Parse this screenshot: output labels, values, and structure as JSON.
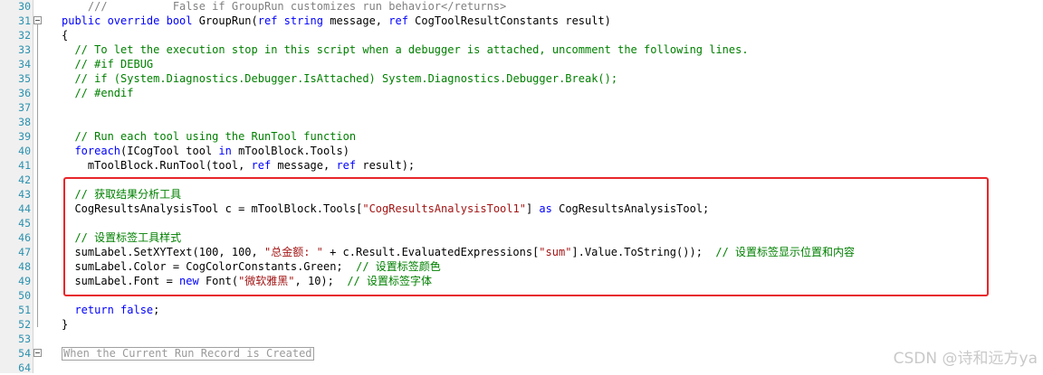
{
  "editor": {
    "lines": [
      {
        "num": "30",
        "parts": [
          {
            "t": "    ///          False if GroupRun customizes run behavior</returns>",
            "c": "doc"
          }
        ]
      },
      {
        "num": "31",
        "parts": [
          {
            "t": "public override bool ",
            "c": "kw"
          },
          {
            "t": "GroupRun(",
            "c": ""
          },
          {
            "t": "ref string ",
            "c": "kw"
          },
          {
            "t": "message, ",
            "c": ""
          },
          {
            "t": "ref ",
            "c": "kw"
          },
          {
            "t": "CogToolResultConstants result)",
            "c": ""
          }
        ]
      },
      {
        "num": "32",
        "parts": [
          {
            "t": "{",
            "c": ""
          }
        ]
      },
      {
        "num": "33",
        "parts": [
          {
            "t": "  // To let the execution stop in this script when a debugger is attached, uncomment the following lines.",
            "c": "cm"
          }
        ]
      },
      {
        "num": "34",
        "parts": [
          {
            "t": "  // #if DEBUG",
            "c": "cm"
          }
        ]
      },
      {
        "num": "35",
        "parts": [
          {
            "t": "  // if (System.Diagnostics.Debugger.IsAttached) System.Diagnostics.Debugger.Break();",
            "c": "cm"
          }
        ]
      },
      {
        "num": "36",
        "parts": [
          {
            "t": "  // #endif",
            "c": "cm"
          }
        ]
      },
      {
        "num": "37",
        "parts": []
      },
      {
        "num": "38",
        "parts": []
      },
      {
        "num": "39",
        "parts": [
          {
            "t": "  // Run each tool using the RunTool function",
            "c": "cm"
          }
        ]
      },
      {
        "num": "40",
        "parts": [
          {
            "t": "  ",
            "c": ""
          },
          {
            "t": "foreach",
            "c": "kw"
          },
          {
            "t": "(ICogTool tool ",
            "c": ""
          },
          {
            "t": "in ",
            "c": "kw"
          },
          {
            "t": "mToolBlock.Tools)",
            "c": ""
          }
        ]
      },
      {
        "num": "41",
        "parts": [
          {
            "t": "    mToolBlock.RunTool(tool, ",
            "c": ""
          },
          {
            "t": "ref ",
            "c": "kw"
          },
          {
            "t": "message, ",
            "c": ""
          },
          {
            "t": "ref ",
            "c": "kw"
          },
          {
            "t": "result);",
            "c": ""
          }
        ]
      },
      {
        "num": "42",
        "parts": []
      },
      {
        "num": "43",
        "parts": [
          {
            "t": "  // 获取结果分析工具",
            "c": "cm"
          }
        ]
      },
      {
        "num": "44",
        "parts": [
          {
            "t": "  CogResultsAnalysisTool c = mToolBlock.Tools[",
            "c": ""
          },
          {
            "t": "\"CogResultsAnalysisTool1\"",
            "c": "str"
          },
          {
            "t": "] ",
            "c": ""
          },
          {
            "t": "as ",
            "c": "kw"
          },
          {
            "t": "CogResultsAnalysisTool;",
            "c": ""
          }
        ]
      },
      {
        "num": "45",
        "parts": []
      },
      {
        "num": "46",
        "parts": [
          {
            "t": "  // 设置标签工具样式",
            "c": "cm"
          }
        ]
      },
      {
        "num": "47",
        "parts": [
          {
            "t": "  sumLabel.SetXYText(100, 100, ",
            "c": ""
          },
          {
            "t": "\"总金额: \"",
            "c": "str"
          },
          {
            "t": " + c.Result.EvaluatedExpressions[",
            "c": ""
          },
          {
            "t": "\"sum\"",
            "c": "str"
          },
          {
            "t": "].Value.ToString());  ",
            "c": ""
          },
          {
            "t": "// 设置标签显示位置和内容",
            "c": "cm"
          }
        ]
      },
      {
        "num": "48",
        "parts": [
          {
            "t": "  sumLabel.Color = CogColorConstants.Green;  ",
            "c": ""
          },
          {
            "t": "// 设置标签颜色",
            "c": "cm"
          }
        ]
      },
      {
        "num": "49",
        "parts": [
          {
            "t": "  sumLabel.Font = ",
            "c": ""
          },
          {
            "t": "new ",
            "c": "kw"
          },
          {
            "t": "Font(",
            "c": ""
          },
          {
            "t": "\"微软雅黑\"",
            "c": "str"
          },
          {
            "t": ", 10);  ",
            "c": ""
          },
          {
            "t": "// 设置标签字体",
            "c": "cm"
          }
        ]
      },
      {
        "num": "50",
        "parts": []
      },
      {
        "num": "51",
        "parts": [
          {
            "t": "  ",
            "c": ""
          },
          {
            "t": "return false",
            "c": "kw"
          },
          {
            "t": ";",
            "c": ""
          }
        ]
      },
      {
        "num": "52",
        "parts": [
          {
            "t": "}",
            "c": ""
          }
        ]
      },
      {
        "num": "53",
        "parts": []
      },
      {
        "num": "54",
        "parts": [
          {
            "t": "When the Current Run Record is Created",
            "c": "collapsed"
          }
        ]
      },
      {
        "num": "64",
        "parts": []
      }
    ]
  },
  "watermark": "CSDN @诗和远方ya"
}
